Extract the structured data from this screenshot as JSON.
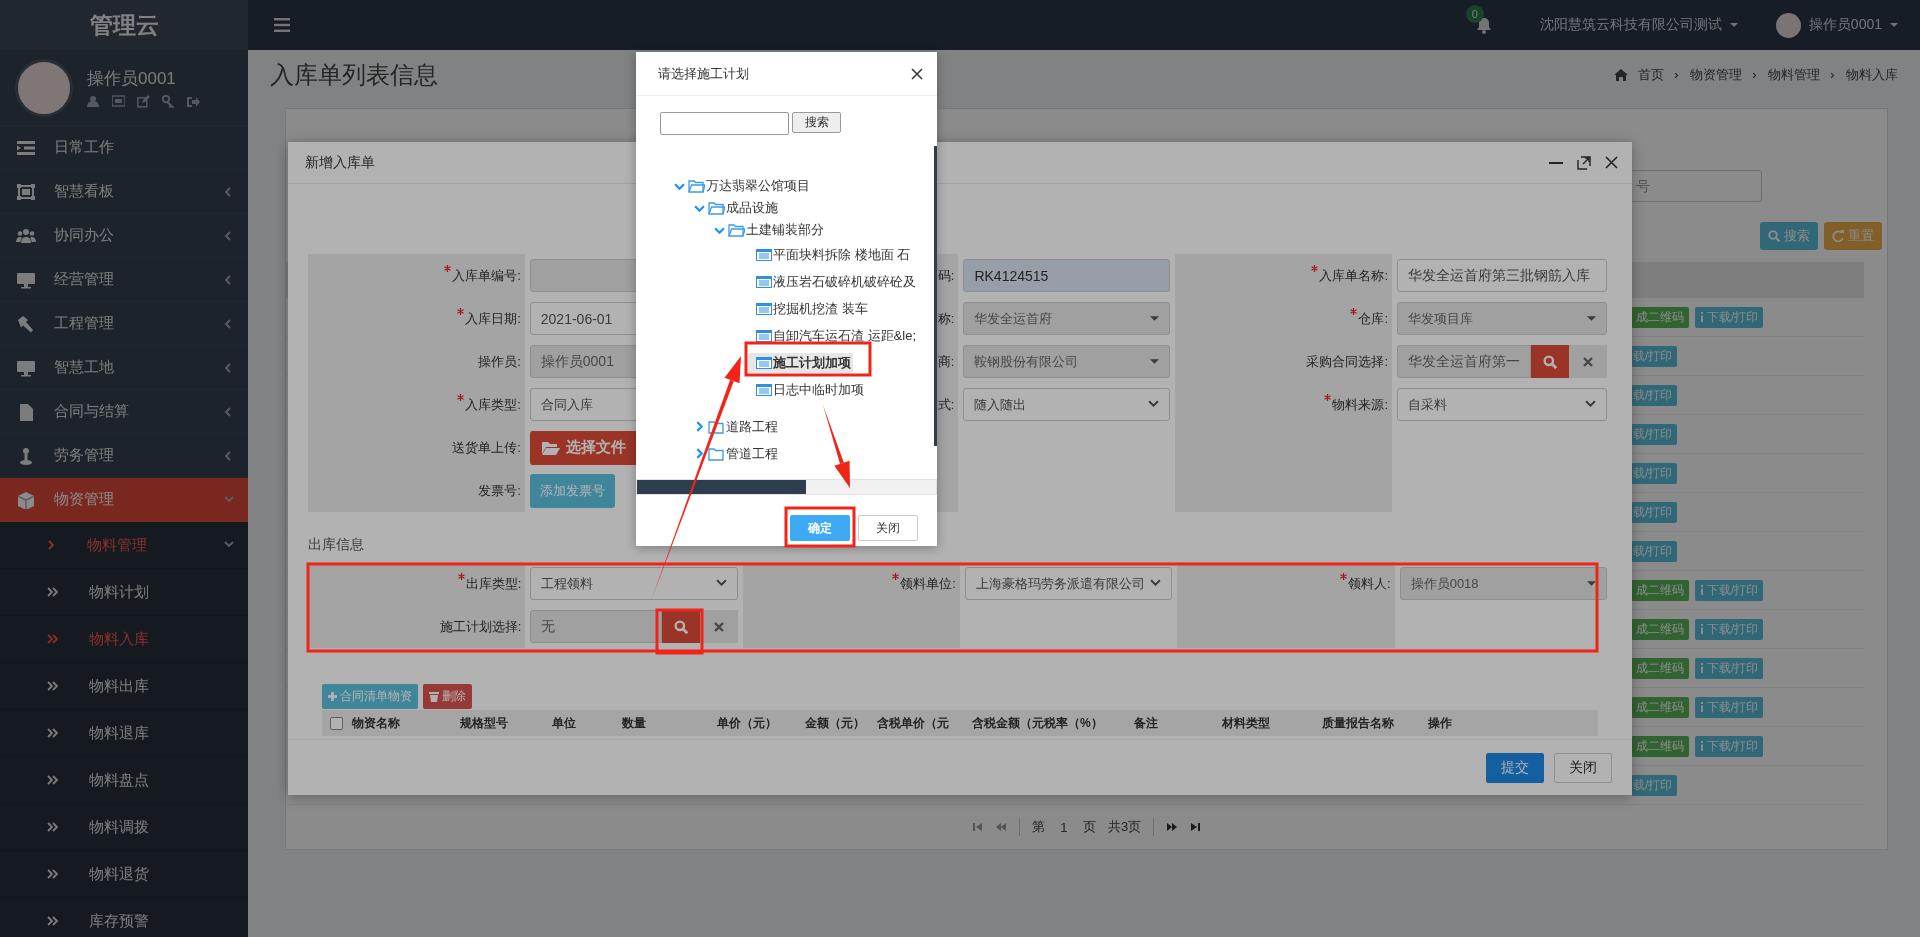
{
  "sidebar": {
    "brand": "管理云",
    "user_name": "操作员0001",
    "menu": [
      {
        "label": "日常工作",
        "kind": "link",
        "selected": false
      },
      {
        "label": "智慧看板",
        "kind": "group",
        "expanded": false,
        "selected": false
      },
      {
        "label": "协同办公",
        "kind": "group",
        "expanded": false,
        "selected": false
      },
      {
        "label": "经营管理",
        "kind": "group",
        "expanded": false,
        "selected": false
      },
      {
        "label": "工程管理",
        "kind": "group",
        "expanded": false,
        "selected": false
      },
      {
        "label": "智慧工地",
        "kind": "group",
        "expanded": false,
        "selected": false
      },
      {
        "label": "合同与结算",
        "kind": "group",
        "expanded": false,
        "selected": false
      },
      {
        "label": "劳务管理",
        "kind": "group",
        "expanded": false,
        "selected": false
      },
      {
        "label": "物资管理",
        "kind": "group",
        "expanded": true,
        "selected": true,
        "children": [
          {
            "label": "物料管理",
            "kind": "group",
            "expanded": true,
            "selected": true,
            "children": [
              {
                "label": "物料计划",
                "selected": false
              },
              {
                "label": "物料入库",
                "selected": true
              },
              {
                "label": "物料出库",
                "selected": false
              },
              {
                "label": "物料退库",
                "selected": false
              },
              {
                "label": "物料盘点",
                "selected": false
              },
              {
                "label": "物料调拨",
                "selected": false
              },
              {
                "label": "物料退货",
                "selected": false
              },
              {
                "label": "库存预警",
                "selected": false
              }
            ]
          }
        ]
      }
    ]
  },
  "topbar": {
    "notification_count": "0",
    "company": "沈阳慧筑云科技有限公司测试",
    "user_name": "操作员0001"
  },
  "page": {
    "title": "入库单列表信息",
    "breadcrumb": [
      "首页",
      "物资管理",
      "物料管理",
      "物料入库"
    ],
    "search": {
      "placeholder": "号"
    },
    "search_buttons": [
      {
        "kind": "search",
        "label": "搜索"
      },
      {
        "kind": "reset",
        "label": "重置"
      }
    ],
    "table": {
      "rows": [
        {
          "actions": [
            {
              "kind": "qrcode",
              "label": "成二维码"
            },
            {
              "kind": "download",
              "label": "下载/打印"
            }
          ]
        },
        {
          "actions": [
            {
              "kind": "download_clipped",
              "label": "载/打印"
            }
          ]
        },
        {
          "actions": [
            {
              "kind": "download_clipped",
              "label": "载/打印"
            }
          ]
        },
        {
          "actions": [
            {
              "kind": "download_clipped",
              "label": "载/打印"
            }
          ]
        },
        {
          "actions": [
            {
              "kind": "download_clipped",
              "label": "载/打印"
            }
          ]
        },
        {
          "actions": [
            {
              "kind": "download_clipped",
              "label": "载/打印"
            }
          ]
        },
        {
          "actions": [
            {
              "kind": "download_clipped",
              "label": "载/打印"
            }
          ]
        },
        {
          "actions": [
            {
              "kind": "qrcode",
              "label": "成二维码"
            },
            {
              "kind": "download",
              "label": "下载/打印"
            }
          ]
        },
        {
          "actions": [
            {
              "kind": "qrcode",
              "label": "成二维码"
            },
            {
              "kind": "download",
              "label": "下载/打印"
            }
          ]
        },
        {
          "actions": [
            {
              "kind": "qrcode",
              "label": "成二维码"
            },
            {
              "kind": "download",
              "label": "下载/打印"
            }
          ]
        },
        {
          "actions": [
            {
              "kind": "qrcode",
              "label": "成二维码"
            },
            {
              "kind": "download",
              "label": "下载/打印"
            }
          ]
        },
        {
          "actions": [
            {
              "kind": "qrcode",
              "label": "成二维码"
            },
            {
              "kind": "download",
              "label": "下载/打印"
            }
          ]
        },
        {
          "actions": [
            {
              "kind": "download_clipped",
              "label": "载/打印"
            }
          ]
        }
      ]
    },
    "pagination": {
      "prefix": "第",
      "page": "1",
      "suffix": "页",
      "total": "共3页"
    }
  },
  "modal": {
    "title": "新增入库单",
    "form": [
      {
        "fields": [
          {
            "label": "入库单编号:",
            "required": true,
            "kind": "input",
            "disabled": true
          },
          {
            "label": "码:",
            "required": false,
            "kind": "readonly",
            "value": "RK4124515",
            "disabled": true
          },
          {
            "label": "入库单名称:",
            "required": true,
            "kind": "input",
            "value": "华发全运首府第三批钢筋入库",
            "disabled": false
          }
        ]
      },
      {
        "fields": [
          {
            "label": "入库日期:",
            "required": true,
            "kind": "input",
            "value": "2021-06-01",
            "disabled": false
          },
          {
            "label": "称:",
            "required": false,
            "kind": "select",
            "value": "华发全运首府",
            "disabled": true
          },
          {
            "label": "仓库:",
            "required": true,
            "kind": "select",
            "value": "华发项目库",
            "disabled": true
          }
        ]
      },
      {
        "fields": [
          {
            "label": "操作员:",
            "required": false,
            "kind": "input",
            "value": "操作员0001",
            "disabled": true
          },
          {
            "label": "商:",
            "required": false,
            "kind": "select",
            "value": "鞍钢股份有限公司",
            "disabled": true
          },
          {
            "label": "采购合同选择:",
            "required": false,
            "kind": "lookup",
            "value": "华发全运首府第一",
            "disabled": true
          }
        ]
      },
      {
        "fields": [
          {
            "label": "入库类型:",
            "required": true,
            "kind": "select",
            "value": "合同入库",
            "disabled": false
          },
          {
            "label": "式:",
            "required": false,
            "kind": "select",
            "value": "随入随出",
            "disabled": false
          },
          {
            "label": "物料来源:",
            "required": true,
            "kind": "select",
            "value": "自采料",
            "disabled": false
          }
        ]
      },
      {
        "fields": [
          {
            "label": "送货单上传:",
            "required": false,
            "kind": "file",
            "value": "选择文件",
            "disabled": false
          }
        ]
      },
      {
        "fields": [
          {
            "label": "发票号:",
            "required": false,
            "kind": "button",
            "value": "添加发票号",
            "disabled": false
          }
        ]
      }
    ],
    "section_title": "出库信息",
    "outbound_form": [
      {
        "fields": [
          {
            "label": "出库类型:",
            "required": true,
            "kind": "select",
            "value": "工程领料",
            "disabled": false
          },
          {
            "label": "领料单位:",
            "required": true,
            "kind": "select",
            "value": "上海豪格玛劳务派遣有限公司",
            "disabled": false
          },
          {
            "label": "领料人:",
            "required": true,
            "kind": "select",
            "value": "操作员0018",
            "disabled": true
          }
        ]
      },
      {
        "fields": [
          {
            "label": "施工计划选择:",
            "required": false,
            "kind": "lookup",
            "value": "无",
            "disabled": true
          }
        ]
      }
    ],
    "toolbar": [
      {
        "kind": "add",
        "label": "合同清单物资"
      },
      {
        "kind": "delete",
        "label": "删除"
      }
    ],
    "table": {
      "select_all": {
        "checked": false
      },
      "columns": [
        "物资名称",
        "规格型号",
        "单位",
        "数量",
        "单价（元）",
        "金额（元）",
        "含税单价（元",
        "含税金额（元",
        "税率（%）",
        "备注",
        "材料类型",
        "质量报告名称",
        "操作"
      ]
    },
    "footer": [
      {
        "kind": "primary",
        "label": "提交"
      },
      {
        "kind": "default",
        "label": "关闭"
      }
    ]
  },
  "plan_dialog": {
    "title": "请选择施工计划",
    "search_button": "搜索",
    "tree": [
      {
        "label": "万达翡翠公馆项目",
        "kind": "folder",
        "expanded": true,
        "selected": false,
        "children": [
          {
            "label": "成品设施",
            "kind": "folder",
            "expanded": true,
            "selected": false,
            "children": [
              {
                "label": "土建铺装部分",
                "kind": "folder",
                "expanded": true,
                "selected": false,
                "children": [
                  {
                    "label": "平面块料拆除 楼地面 石",
                    "kind": "leaf",
                    "selected": false
                  },
                  {
                    "label": "液压岩石破碎机破碎砼及",
                    "kind": "leaf",
                    "selected": false
                  },
                  {
                    "label": "挖掘机挖渣 装车",
                    "kind": "leaf",
                    "selected": false
                  },
                  {
                    "label": "自卸汽车运石渣 运距&le;",
                    "kind": "leaf",
                    "selected": false
                  },
                  {
                    "label": "施工计划加项",
                    "kind": "leaf",
                    "selected": true
                  },
                  {
                    "label": "日志中临时加项",
                    "kind": "leaf",
                    "selected": false
                  }
                ]
              }
            ]
          },
          {
            "label": "道路工程",
            "kind": "folder",
            "expanded": false,
            "selected": false
          },
          {
            "label": "管道工程",
            "kind": "folder",
            "expanded": false,
            "selected": false
          }
        ]
      }
    ],
    "buttons": [
      {
        "kind": "primary",
        "label": "确定"
      },
      {
        "kind": "default",
        "label": "关闭"
      }
    ]
  }
}
